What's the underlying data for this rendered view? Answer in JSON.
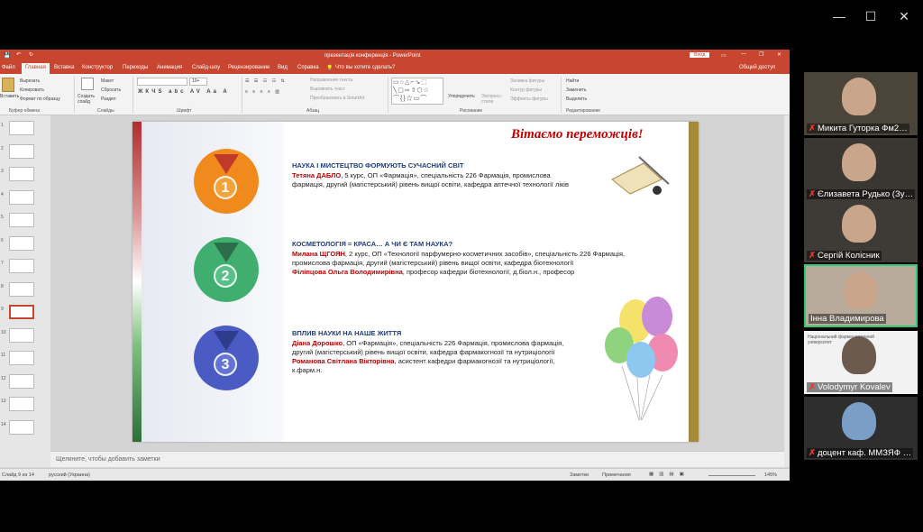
{
  "window": {
    "minimize": "—",
    "maximize": "☐",
    "close": "✕"
  },
  "ppt": {
    "doc_title": "презентація конференція  -  PowerPoint",
    "signin": "Вход",
    "tabs": [
      "Файл",
      "Главная",
      "Вставка",
      "Конструктор",
      "Переходы",
      "Анимация",
      "Слайд-шоу",
      "Рецензирование",
      "Вид",
      "Справка"
    ],
    "tell_me": "Что вы хотите сделать?",
    "share": "Общий доступ",
    "ribbon": {
      "paste": "Вставить",
      "cut": "Вырезать",
      "copy": "Копировать",
      "format_painter": "Формат по образцу",
      "new_slide": "Создать слайд",
      "layout": "Макет",
      "reset": "Сбросить",
      "section": "Раздел",
      "font_size": "10+",
      "text_dir": "Направление текста",
      "align_text": "Выровнять текст",
      "smartart": "Преобразовать в SmartArt",
      "arrange": "Упорядочить",
      "quick_styles": "Экспресс-стили",
      "shape_fill": "Заливка фигуры",
      "shape_outline": "Контур фигуры",
      "shape_effects": "Эффекты фигуры",
      "find": "Найти",
      "replace": "Заменить",
      "select": "Выделить",
      "groups": [
        "Буфер обмена",
        "Слайды",
        "Шрифт",
        "Абзац",
        "Рисование",
        "Редактирование"
      ]
    },
    "thumbs": [
      "1",
      "2",
      "3",
      "4",
      "5",
      "6",
      "7",
      "8",
      "9",
      "10",
      "11",
      "12",
      "13",
      "14"
    ],
    "notes_placeholder": "Щелкните, чтобы добавить заметки",
    "status": {
      "slide": "Слайд 9 из 14",
      "lang": "русский (Украина)",
      "notes": "Заметки",
      "comments": "Примечания",
      "zoom": "145%"
    }
  },
  "slide": {
    "header": "Вітаємо переможців!",
    "items": [
      {
        "medal": "1",
        "title": "НАУКА І МИСТЕЦТВО ФОРМУЮТЬ СУЧАСНИЙ СВІТ",
        "name": "Тетяна ДАБЛО",
        "line1": ", 5 курс, ОП «Фармація», спеціальність 226 Фармація, промислова",
        "line2": "фармація, другий (магістерський) рівень вищої освіти, кафедра аптечної технології ліків"
      },
      {
        "medal": "2",
        "title": "КОСМЕТОЛОГІЯ = КРАСА… А ЧИ Є ТАМ НАУКА?",
        "name": "Милана ЩГОЯН",
        "line1": ", 2 курс, ОП «Технології парфумерно-косметичних засобів», спеціальність 226 Фармація,",
        "line2": "промислова фармація, другий (магістерський) рівень вищої освіти, кафедра біотехнології",
        "advisor": "Філіпцова Ольга Володимирівна",
        "advisor_rest": ", професор кафедри біотехнології, д.біол.н., професор"
      },
      {
        "medal": "3",
        "title": "ВПЛИВ НАУКИ НА НАШЕ ЖИТТЯ",
        "name": "Діана Дорошко",
        "line1": ", ОП «Фармація», спеціальність 226 Фармація, промислова фармація,",
        "line2": "другий (магістерський) рівень вищої освіти, кафедра фармакогнозії та нутриціології",
        "advisor": "Романова Світлана Вікторівна",
        "advisor_rest": ", асистент кафедри фармакогнозії та нутриціології,",
        "line4": "к.фарм.н."
      }
    ]
  },
  "participants": [
    {
      "name": "Микита Гуторка Фм2…",
      "muted": true
    },
    {
      "name": "Єлизавета Рудько (Зу…",
      "muted": true
    },
    {
      "name": "Сергій Колісник",
      "muted": true
    },
    {
      "name": "Інна Владимирова",
      "muted": false
    },
    {
      "name": "Volodymyr Kovalev",
      "muted": true,
      "caption": "Національний фармацевтичний університет"
    },
    {
      "name": "доцент каф. ММЗЯФ …",
      "muted": true
    }
  ],
  "colors": {
    "ppt_accent": "#c8452f",
    "active_speaker": "#2ecc71",
    "gold": "#f08a1c",
    "silver": "#3fae6e",
    "bronze": "#4a5bc4"
  }
}
